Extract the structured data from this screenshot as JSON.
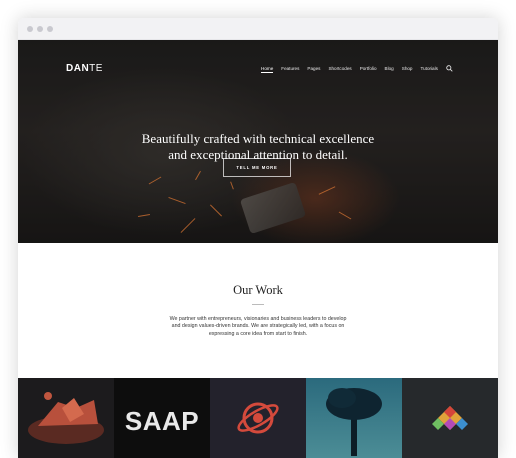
{
  "site": {
    "logo": {
      "bold": "DAN",
      "light": "TE"
    },
    "nav": [
      "Home",
      "Features",
      "Pages",
      "Shortcodes",
      "Portfolio",
      "Blog",
      "Shop",
      "Tutorials"
    ],
    "icons": {
      "search": "search-icon"
    }
  },
  "hero": {
    "line1": "Beautifully crafted with technical excellence",
    "line2": "and exceptional attention to detail.",
    "cta": "TELL ME MORE"
  },
  "work": {
    "title": "Our Work",
    "line1": "We partner with entrepreneurs, visionaries and business leaders to develop",
    "line2": "and design values-driven brands. We are strategically led, with a focus on",
    "line3": "expressing a core idea from start to finish."
  },
  "portfolio": {
    "tile2_text": "SAAP",
    "colors": [
      "#1c1b1d",
      "#0d0d0d",
      "#23222c",
      "#3e7f8c",
      "#26292c"
    ]
  }
}
